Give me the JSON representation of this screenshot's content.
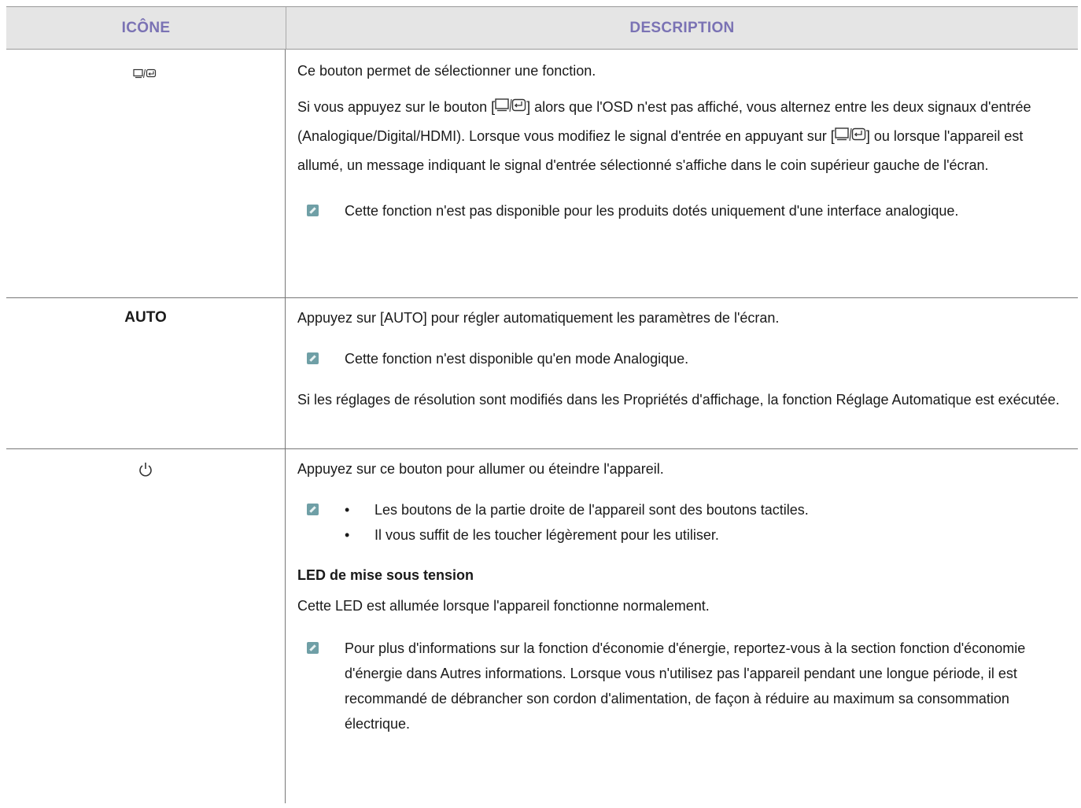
{
  "header": {
    "col_icon": "ICÔNE",
    "col_description": "DESCRIPTION"
  },
  "rows": [
    {
      "icon": "source-enter-icon",
      "p1": "Ce bouton permet de sélectionner une fonction.",
      "p2a": "Si vous appuyez sur le bouton [",
      "p2b": "] alors que l'OSD n'est pas affiché, vous alternez entre les deux signaux d'entrée (Analogique/Digital/HDMI). Lorsque vous modifiez le signal d'entrée en appuyant sur [",
      "p2c": "] ou lorsque l'appareil est allumé, un message indiquant le signal d'entrée sélectionné s'affiche dans le coin supérieur gauche de l'écran.",
      "note": "Cette fonction n'est pas disponible pour les produits dotés uniquement d'une interface analogique."
    },
    {
      "label": "AUTO",
      "p1": "Appuyez sur [AUTO] pour régler automatiquement les paramètres de l'écran.",
      "note": "Cette fonction n'est disponible qu'en mode Analogique.",
      "p2": "Si les réglages de résolution sont modifiés dans les Propriétés d'affichage, la fonction Réglage Automatique est exécutée."
    },
    {
      "icon": "power-icon",
      "p1": "Appuyez sur ce bouton pour allumer ou éteindre l'appareil.",
      "bullet1": "Les boutons de la partie droite de l'appareil sont des boutons tactiles.",
      "bullet2": "Il vous suffit de les toucher légèrement pour les utiliser.",
      "heading": "LED de mise sous tension",
      "p2": "Cette LED est allumée lorsque l'appareil fonctionne normalement.",
      "note": "Pour plus d'informations sur la fonction d'économie d'énergie, reportez-vous à la section fonction d'économie d'énergie dans Autres informations. Lorsque vous n'utilisez pas l'appareil pendant une longue période, il est recommandé de débrancher son cordon d'alimentation, de façon à réduire au maximum sa consommation électrique."
    }
  ],
  "colors": {
    "header_text": "#7a72b4",
    "header_bg": "#e5e5e5",
    "note_icon": "#6f9fa6"
  }
}
